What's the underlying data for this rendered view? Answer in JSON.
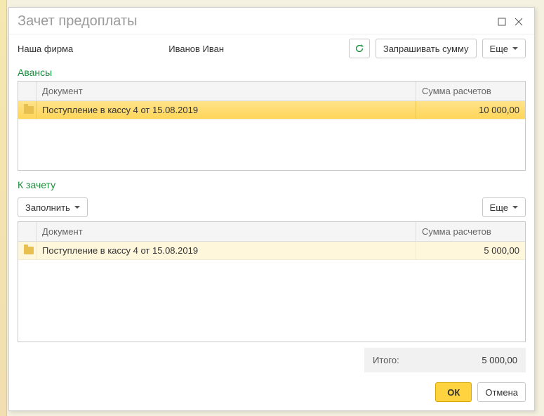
{
  "window": {
    "title": "Зачет предоплаты"
  },
  "top": {
    "firm": "Наша фирма",
    "person": "Иванов Иван",
    "request_sum": "Запрашивать сумму",
    "more": "Еще"
  },
  "sections": {
    "advances": "Авансы",
    "to_offset": "К зачету"
  },
  "columns": {
    "doc": "Документ",
    "sum": "Сумма расчетов"
  },
  "advances": {
    "rows": [
      {
        "doc": "Поступление в кассу 4 от 15.08.2019",
        "sum": "10 000,00"
      }
    ]
  },
  "offset_bar": {
    "fill": "Заполнить",
    "more": "Еще"
  },
  "offset": {
    "rows": [
      {
        "doc": "Поступление в кассу 4 от 15.08.2019",
        "sum": "5 000,00"
      }
    ]
  },
  "totals": {
    "label": "Итого:",
    "value": "5 000,00"
  },
  "footer": {
    "ok": "ОК",
    "cancel": "Отмена"
  }
}
